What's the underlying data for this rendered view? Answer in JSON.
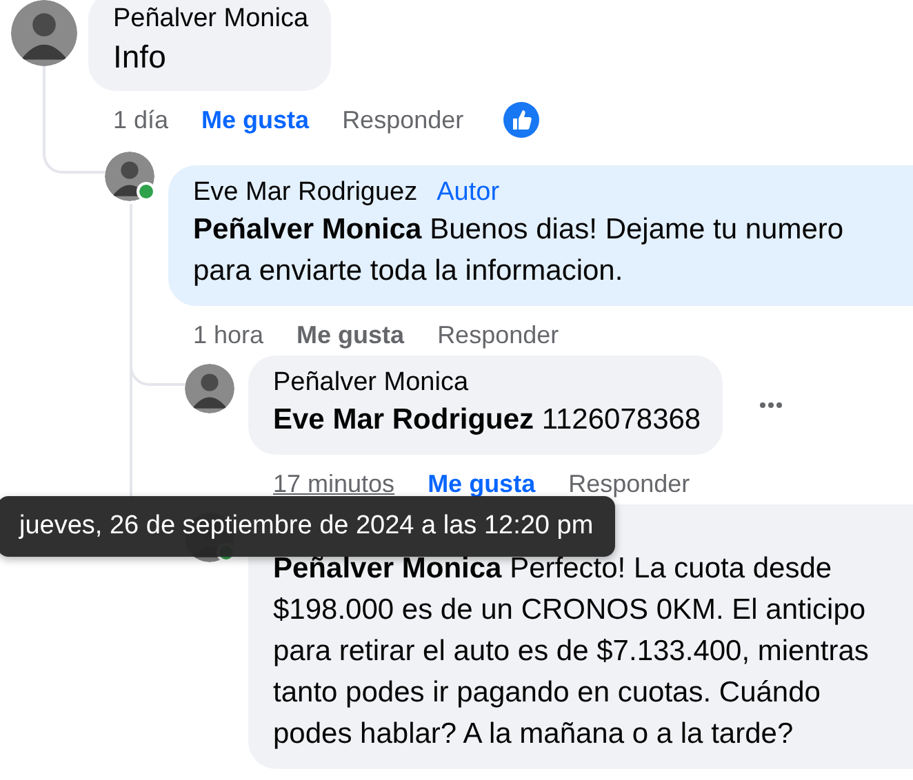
{
  "comments": [
    {
      "author": "Peñalver Monica",
      "text": "Info",
      "highlighted": false,
      "actions": {
        "time": "1 día",
        "time_hovered": false,
        "like": "Me gusta",
        "liked": true,
        "reply": "Responder",
        "like_reaction": true
      },
      "children": [
        {
          "author": "Eve Mar Rodriguez",
          "badge": "Autor",
          "text": "**Peñalver Monica** Buenos dias! Dejame tu numero para enviarte toda la informacion.",
          "highlighted": true,
          "online": true,
          "actions": {
            "time": "1 hora",
            "time_hovered": false,
            "like": "Me gusta",
            "liked": false,
            "reply": "Responder"
          },
          "children": [
            {
              "author": "Peñalver Monica",
              "text": "**Eve Mar Rodriguez** 1126078368",
              "highlighted": false,
              "actions": {
                "time": "17 minutos",
                "time_hovered": true,
                "tooltip": "jueves, 26 de septiembre de 2024 a las 12:20 pm",
                "like": "Me gusta",
                "liked": true,
                "reply": "Responder"
              },
              "more_button": true
            },
            {
              "text": "**Peñalver Monica** Perfecto! La cuota desde $198.000 es de un CRONOS 0KM. El anticipo para retirar el auto es de $7.133.400, mientras tanto podes ir pagando en cuotas. Cuándo podes hablar? A la mañana o a la tarde?",
              "highlighted": false,
              "online": true
            }
          ]
        }
      ]
    }
  ]
}
